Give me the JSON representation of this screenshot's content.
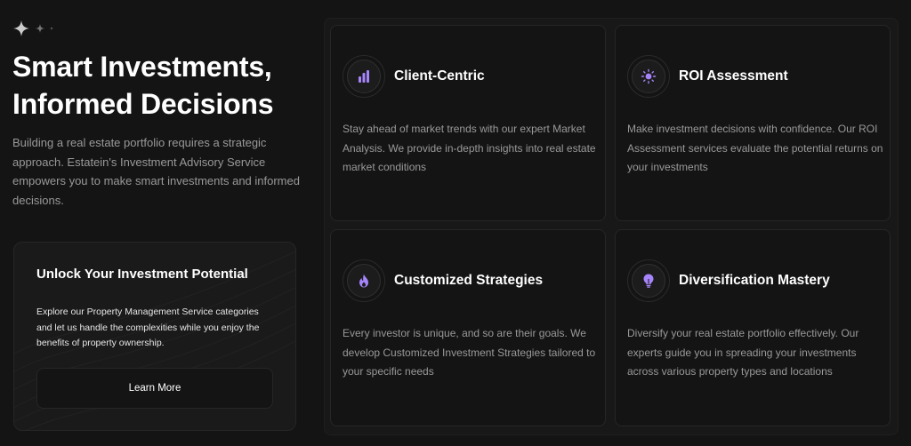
{
  "hero": {
    "headline_line1": "Smart Investments,",
    "headline_line2": "Informed Decisions",
    "intro": "Building a real estate portfolio requires a strategic approach. Estatein's Investment Advisory Service empowers you to make smart investments and informed decisions."
  },
  "cta": {
    "title": "Unlock Your Investment Potential",
    "text": "Explore our Property Management Service categories and let us handle the complexities while you enjoy the benefits of property ownership.",
    "button_label": "Learn More"
  },
  "cards": [
    {
      "title": "Client-Centric",
      "icon": "bar-chart-icon",
      "text": "Stay ahead of market trends with our expert Market Analysis. We provide in-depth insights into real estate market conditions"
    },
    {
      "title": "ROI Assessment",
      "icon": "sun-icon",
      "text": "Make investment decisions with confidence. Our ROI Assessment services evaluate the potential returns on your investments"
    },
    {
      "title": "Customized Strategies",
      "icon": "flame-icon",
      "text": "Every investor is unique, and so are their goals. We develop Customized Investment Strategies tailored to your specific needs"
    },
    {
      "title": "Diversification Mastery",
      "icon": "lightbulb-icon",
      "text": "Diversify your real estate portfolio effectively. Our experts guide you in spreading your investments across various property types and locations"
    }
  ],
  "colors": {
    "background": "#141414",
    "accent": "#a685fa",
    "text_primary": "#ffffff",
    "text_secondary": "#999999",
    "border": "#262626"
  }
}
